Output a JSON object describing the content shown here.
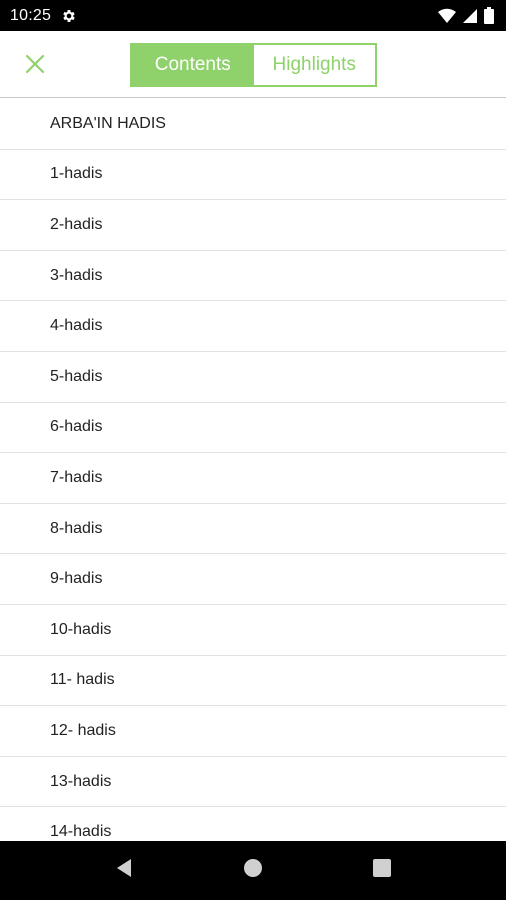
{
  "status_bar": {
    "time": "10:25",
    "icons": [
      "settings-icon",
      "wifi-icon",
      "signal-icon",
      "battery-icon"
    ]
  },
  "toolbar": {
    "close_icon": "close-icon",
    "tabs": [
      {
        "label": "Contents",
        "active": true
      },
      {
        "label": "Highlights",
        "active": false
      }
    ],
    "accent_color": "#8fd16a"
  },
  "contents": {
    "items": [
      {
        "label": "ARBA'IN HADIS"
      },
      {
        "label": "1-hadis"
      },
      {
        "label": "2-hadis"
      },
      {
        "label": "3-hadis"
      },
      {
        "label": "4-hadis"
      },
      {
        "label": "5-hadis"
      },
      {
        "label": "6-hadis"
      },
      {
        "label": "7-hadis"
      },
      {
        "label": "8-hadis"
      },
      {
        "label": "9-hadis"
      },
      {
        "label": "10-hadis"
      },
      {
        "label": "11- hadis"
      },
      {
        "label": "12- hadis"
      },
      {
        "label": "13-hadis"
      },
      {
        "label": "14-hadis"
      }
    ]
  },
  "nav_bar": {
    "buttons": [
      "back-icon",
      "home-icon",
      "recents-icon"
    ]
  }
}
